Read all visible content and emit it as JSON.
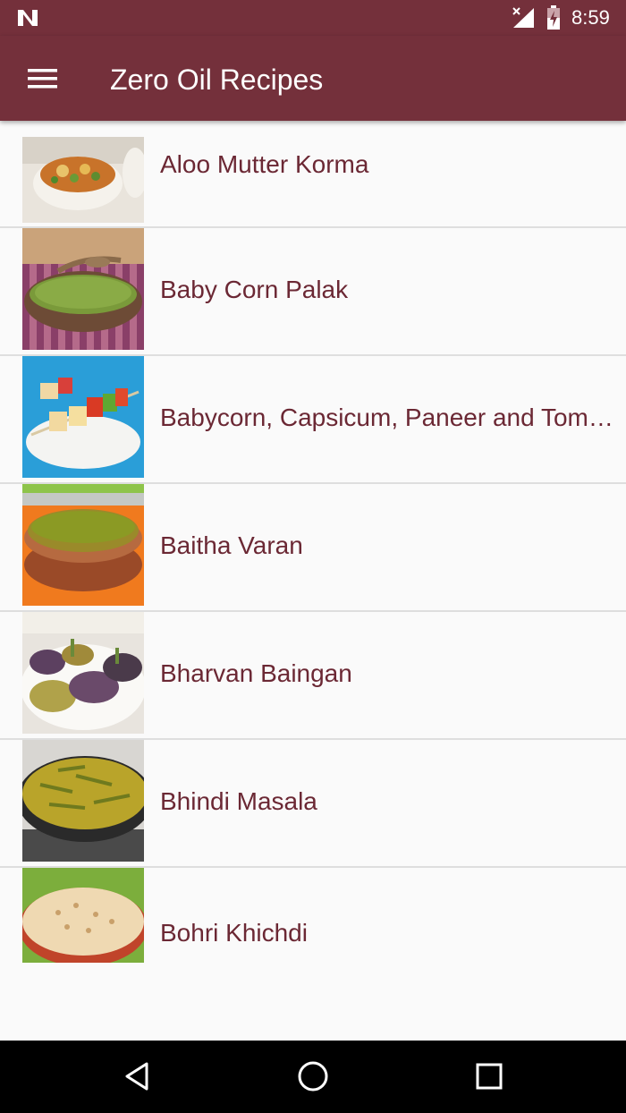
{
  "status_bar": {
    "time": "8:59",
    "icons": [
      "n-notification-icon",
      "signal-no-data-icon",
      "battery-icon"
    ]
  },
  "app_bar": {
    "title": "Zero Oil Recipes",
    "menu_icon": "hamburger-menu-icon"
  },
  "recipes": [
    {
      "name": "Aloo Mutter Korma"
    },
    {
      "name": "Baby Corn Palak"
    },
    {
      "name": " Babycorn, Capsicum, Paneer and Tomato Kebabs"
    },
    {
      "name": "Baitha Varan"
    },
    {
      "name": "Bharvan Baingan"
    },
    {
      "name": "Bhindi Masala"
    },
    {
      "name": "Bohri Khichdi"
    }
  ],
  "nav_bar": {
    "icons": [
      "back-icon",
      "home-icon",
      "recents-icon"
    ]
  },
  "colors": {
    "primary": "#74303b",
    "list_text": "#6b2834",
    "background": "#fafafa",
    "divider": "#dedede"
  }
}
